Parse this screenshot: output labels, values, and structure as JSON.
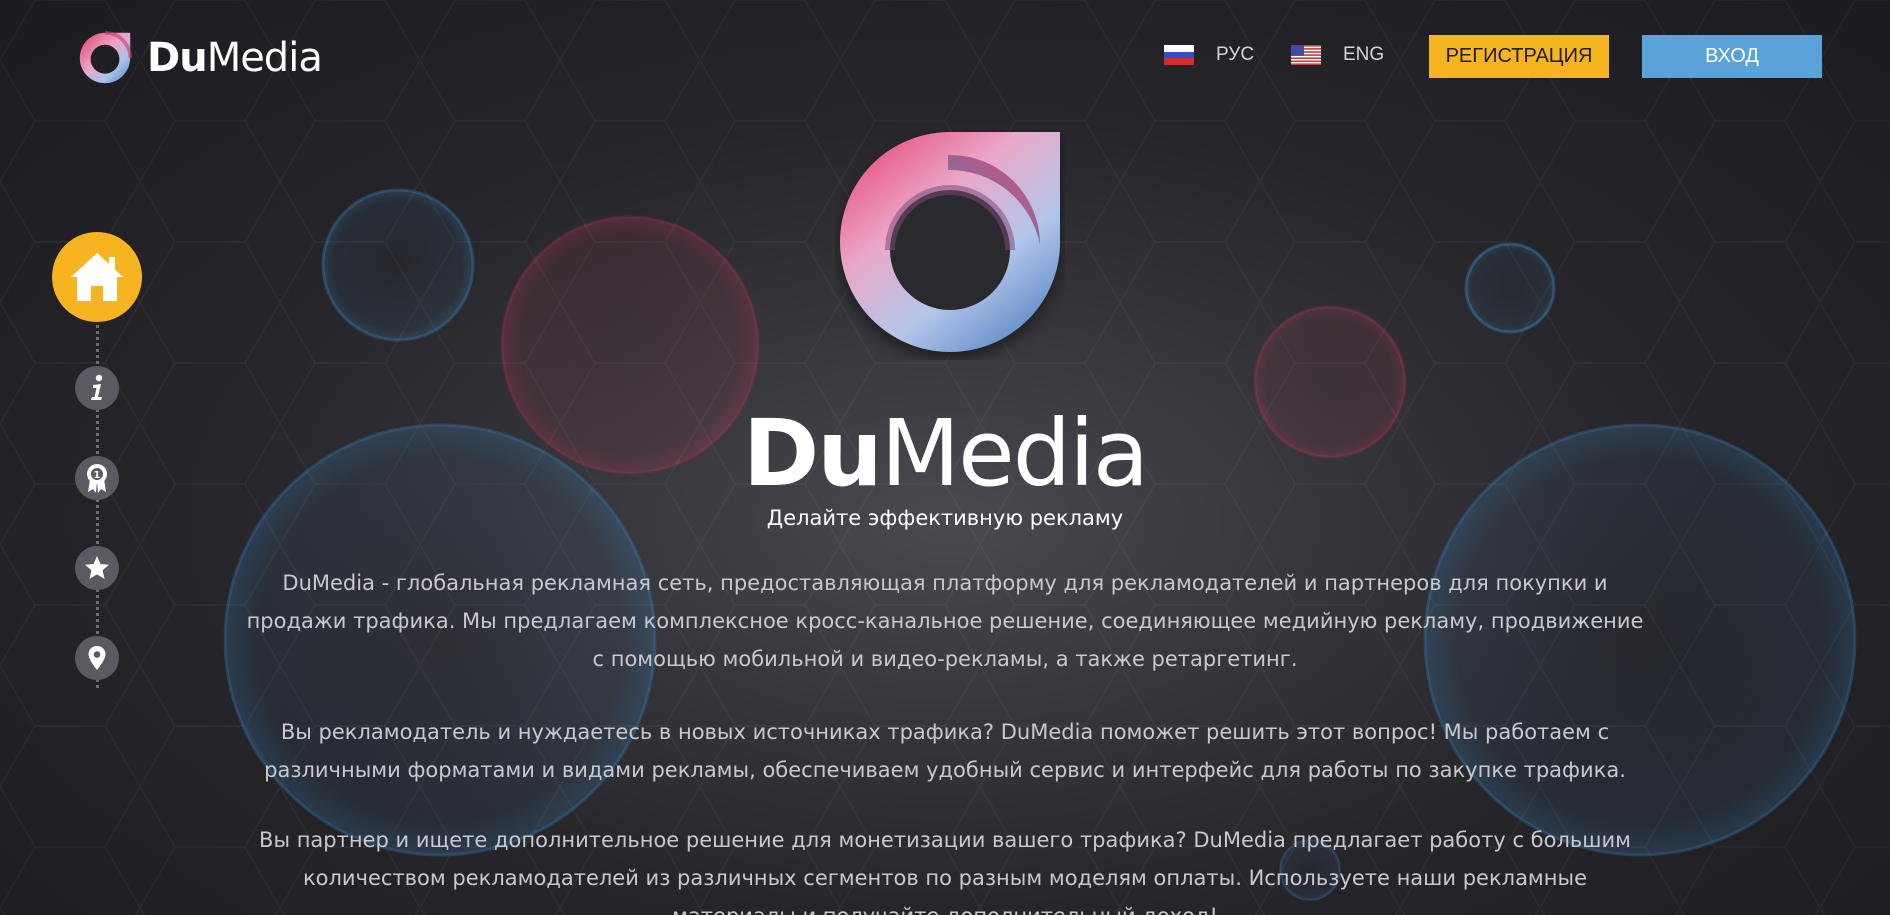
{
  "header": {
    "logo": {
      "brand_bold": "Du",
      "brand_regular": "Media",
      "icon": "dumedia-ring-logo"
    },
    "languages": [
      {
        "flag": "russia-flag-icon",
        "label": "РУС"
      },
      {
        "flag": "usa-flag-icon",
        "label": "ENG"
      }
    ],
    "register_label": "РЕГИСТРАЦИЯ",
    "login_label": "ВХОД"
  },
  "sidenav": {
    "items": [
      {
        "icon": "home-icon",
        "active": true
      },
      {
        "icon": "info-icon",
        "active": false
      },
      {
        "icon": "award-icon",
        "active": false
      },
      {
        "icon": "star-icon",
        "active": false
      },
      {
        "icon": "location-pin-icon",
        "active": false
      }
    ]
  },
  "hero": {
    "title_bold": "Du",
    "title_regular": "Media",
    "subtitle": "Делайте эффективную рекламу",
    "paragraphs": [
      "DuMedia - глобальная рекламная сеть, предоставляющая платформу для рекламодателей и партнеров для покупки и продажи трафика. Мы предлагаем комплексное кросс-канальное решение, соединяющее медийную рекламу, продвижение с помощью мобильной и видео-рекламы, а также ретаргетинг.",
      "Вы рекламодатель и нуждаетесь в новых источниках трафика? DuMedia поможет решить этот вопрос! Мы работаем с различными форматами и видами рекламы, обеспечиваем удобный сервис и интерфейс для работы по закупке трафика.",
      "Вы партнер и ищете дополнительное решение для монетизации вашего трафика? DuMedia предлагает работу с большим количеством рекламодателей из различных сегментов по разным моделям оплаты. Используете наши рекламные материалы и получайте дополнительный доход!"
    ]
  },
  "colors": {
    "accent_yellow": "#f6b520",
    "accent_blue": "#5aa3d8",
    "background": "#1d1c21",
    "text_muted": "#c9c8d0"
  }
}
